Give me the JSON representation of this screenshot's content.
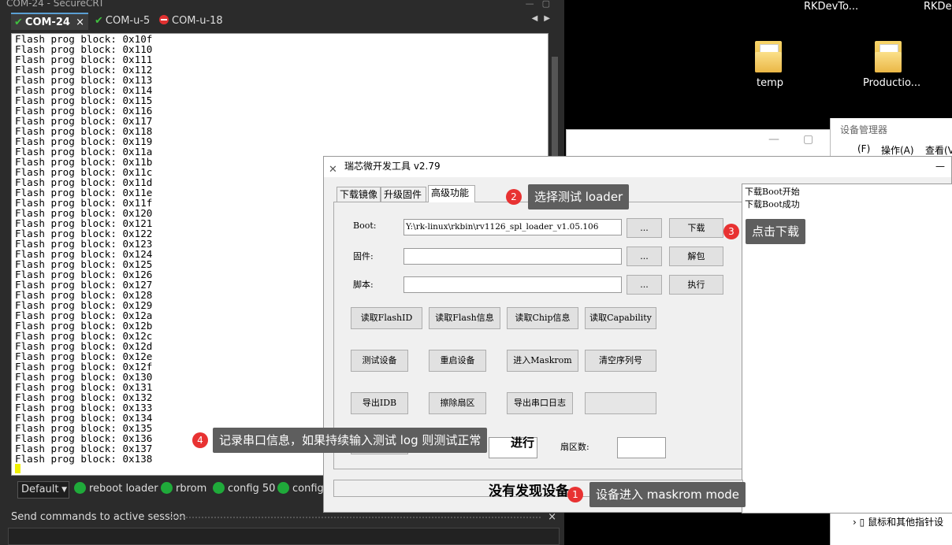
{
  "securecrt": {
    "title": "COM-24 - SecureCRT",
    "tabs": [
      {
        "label": "COM-24",
        "close": "×"
      },
      {
        "label": "COM-u-5"
      },
      {
        "label": "COM-u-18"
      }
    ],
    "terminal_lines": [
      "Flash prog block: 0x10f",
      "Flash prog block: 0x110",
      "Flash prog block: 0x111",
      "Flash prog block: 0x112",
      "Flash prog block: 0x113",
      "Flash prog block: 0x114",
      "Flash prog block: 0x115",
      "Flash prog block: 0x116",
      "Flash prog block: 0x117",
      "Flash prog block: 0x118",
      "Flash prog block: 0x119",
      "Flash prog block: 0x11a",
      "Flash prog block: 0x11b",
      "Flash prog block: 0x11c",
      "Flash prog block: 0x11d",
      "Flash prog block: 0x11e",
      "Flash prog block: 0x11f",
      "Flash prog block: 0x120",
      "Flash prog block: 0x121",
      "Flash prog block: 0x122",
      "Flash prog block: 0x123",
      "Flash prog block: 0x124",
      "Flash prog block: 0x125",
      "Flash prog block: 0x126",
      "Flash prog block: 0x127",
      "Flash prog block: 0x128",
      "Flash prog block: 0x129",
      "Flash prog block: 0x12a",
      "Flash prog block: 0x12b",
      "Flash prog block: 0x12c",
      "Flash prog block: 0x12d",
      "Flash prog block: 0x12e",
      "Flash prog block: 0x12f",
      "Flash prog block: 0x130",
      "Flash prog block: 0x131",
      "Flash prog block: 0x132",
      "Flash prog block: 0x133",
      "Flash prog block: 0x134",
      "Flash prog block: 0x135",
      "Flash prog block: 0x136",
      "Flash prog block: 0x137",
      "Flash prog block: 0x138"
    ],
    "session_select": "Default",
    "button_bar": [
      "reboot loader",
      "rbrom",
      "config 50",
      "config"
    ],
    "send_bar_label": "Send commands to active session",
    "send_bar_close": "×"
  },
  "desktop": {
    "icons": [
      {
        "label": "RKDevTo..."
      },
      {
        "label": "RKDev"
      },
      {
        "label": "temp"
      },
      {
        "label": "Productio..."
      }
    ],
    "device_manager": {
      "title": "设备管理器",
      "menu": [
        "(F)",
        "操作(A)",
        "查看(V)"
      ],
      "tree_item": "鼠标和其他指针设"
    }
  },
  "rktool": {
    "title": "瑞芯微开发工具 v2.79",
    "tabs": [
      "下载镜像",
      "升级固件",
      "高级功能"
    ],
    "boot_label": "Boot:",
    "boot_path": "Y:\\rk-linux\\rkbin\\rv1126_spl_loader_v1.05.106",
    "firmware_label": "固件:",
    "script_label": "脚本:",
    "browse_label": "...",
    "download_button": "下载",
    "unpack_button": "解包",
    "execute_button": "执行",
    "row1": [
      "读取FlashID",
      "读取Flash信息",
      "读取Chip信息",
      "读取Capability"
    ],
    "row2": [
      "测试设备",
      "重启设备",
      "进入Maskrom",
      "清空序列号"
    ],
    "row3": [
      "导出IDB",
      "擦除扇区",
      "导出串口日志"
    ],
    "progress_label": "进行",
    "sector_count_label": "扇区数:",
    "log_lines": [
      "下载Boot开始",
      "下载Boot成功"
    ],
    "status_text": "没有发现设备"
  },
  "annotations": [
    {
      "num": "1",
      "text": "设备进入 maskrom mode"
    },
    {
      "num": "2",
      "text": "选择测试 loader"
    },
    {
      "num": "3",
      "text": "点击下载"
    },
    {
      "num": "4",
      "text": "记录串口信息，如果持续输入测试 log 则测试正常"
    }
  ],
  "colors": {
    "crt_bg": "#2b2b2b",
    "active_tab": "#5a9fd4",
    "callout_bg": "#5e5e5e",
    "badge_red": "#e83232",
    "green_dot": "#1faa3a"
  }
}
